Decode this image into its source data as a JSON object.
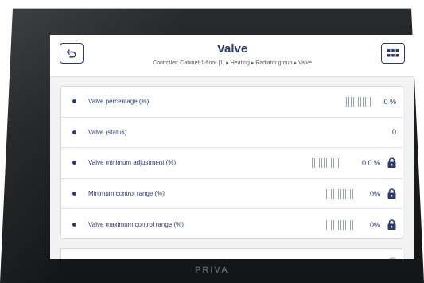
{
  "header": {
    "title": "Valve",
    "breadcrumb": "Controller: Cabinet-1-floor [1] ▸ Heating ▸ Radiator group ▸ Valve",
    "back_icon": "back-arrow-icon",
    "menu_icon": "grid-menu-icon"
  },
  "rows": [
    {
      "label": "Valve percentage (%)",
      "value": "0 %",
      "has_bar": true,
      "locked": false
    },
    {
      "label": "Valve (status)",
      "value": "0",
      "has_bar": false,
      "locked": false
    },
    {
      "label": "Valve minimum adjustment (%)",
      "value": "0.0 %",
      "has_bar": true,
      "locked": true
    },
    {
      "label": "Minimum control range (%)",
      "value": "0%",
      "has_bar": true,
      "locked": true
    },
    {
      "label": "Valve maximum control range (%)",
      "value": "0%",
      "has_bar": true,
      "locked": true
    }
  ],
  "brand": "PRIVA",
  "colors": {
    "accent": "#2b3a73",
    "background": "#f2f2f2"
  }
}
